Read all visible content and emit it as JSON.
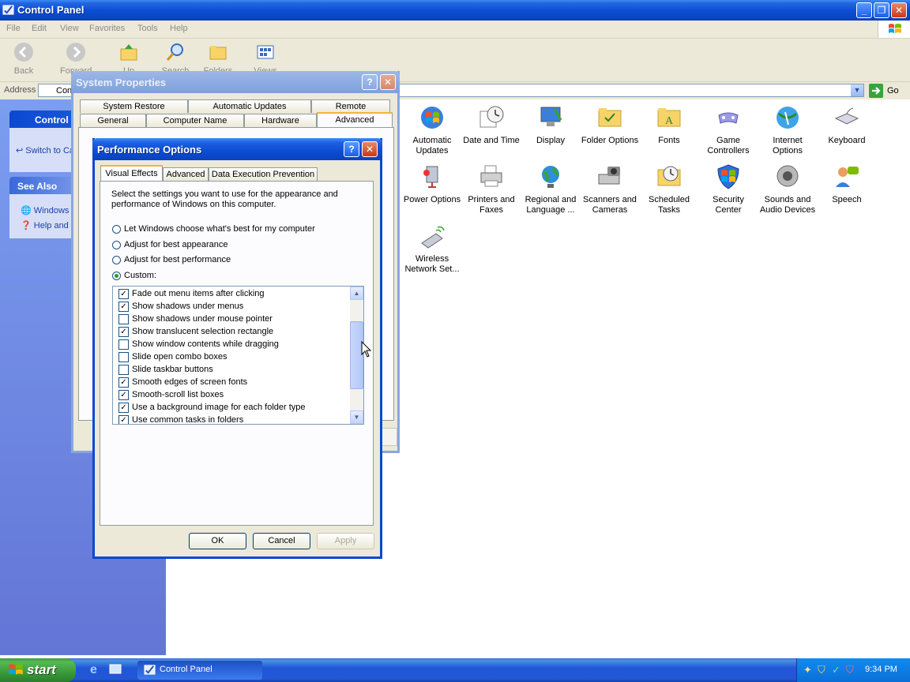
{
  "window": {
    "title": "Control Panel",
    "menu": [
      "File",
      "Edit",
      "View",
      "Favorites",
      "Tools",
      "Help"
    ],
    "toolbar": {
      "back": "Back",
      "forward": "Forward",
      "up": "Up",
      "search": "Search",
      "folders": "Folders",
      "views": "Views"
    },
    "address": {
      "label": "Address",
      "value": "Control Panel",
      "go": "Go"
    }
  },
  "left_pane": {
    "control_panel_title": "Control Panel",
    "switch_link": "Switch to Category View",
    "see_also_title": "See Also",
    "see_also": [
      "Windows Update",
      "Help and Support"
    ]
  },
  "control_panel_items": [
    {
      "label": "Automatic Updates",
      "icon": "automatic-updates-icon"
    },
    {
      "label": "Date and Time",
      "icon": "date-time-icon"
    },
    {
      "label": "Display",
      "icon": "display-icon"
    },
    {
      "label": "Folder Options",
      "icon": "folder-options-icon"
    },
    {
      "label": "Fonts",
      "icon": "fonts-icon"
    },
    {
      "label": "Game Controllers",
      "icon": "game-controllers-icon"
    },
    {
      "label": "Internet Options",
      "icon": "internet-options-icon"
    },
    {
      "label": "Keyboard",
      "icon": "keyboard-icon"
    },
    {
      "label": "Power Options",
      "icon": "power-options-icon"
    },
    {
      "label": "Printers and Faxes",
      "icon": "printers-icon"
    },
    {
      "label": "Regional and Language ...",
      "icon": "regional-icon"
    },
    {
      "label": "Scanners and Cameras",
      "icon": "scanners-icon"
    },
    {
      "label": "Scheduled Tasks",
      "icon": "scheduled-tasks-icon"
    },
    {
      "label": "Security Center",
      "icon": "security-center-icon"
    },
    {
      "label": "Sounds and Audio Devices",
      "icon": "sounds-icon"
    },
    {
      "label": "Speech",
      "icon": "speech-icon"
    },
    {
      "label": "Wireless Network Set...",
      "icon": "wireless-icon"
    }
  ],
  "system_properties": {
    "title": "System Properties",
    "tabs_back": [
      "System Restore",
      "Automatic Updates",
      "Remote"
    ],
    "tabs_front": [
      "General",
      "Computer Name",
      "Hardware",
      "Advanced"
    ],
    "active_tab": "Advanced"
  },
  "performance_options": {
    "title": "Performance Options",
    "tabs": [
      "Visual Effects",
      "Advanced",
      "Data Execution Prevention"
    ],
    "active_tab": "Visual Effects",
    "description": "Select the settings you want to use for the appearance and performance of Windows on this computer.",
    "radios": [
      {
        "label": "Let Windows choose what's best for my computer",
        "checked": false
      },
      {
        "label": "Adjust for best appearance",
        "checked": false
      },
      {
        "label": "Adjust for best performance",
        "checked": false
      },
      {
        "label": "Custom:",
        "checked": true
      }
    ],
    "effects": [
      {
        "label": "Fade out menu items after clicking",
        "checked": true
      },
      {
        "label": "Show shadows under menus",
        "checked": true
      },
      {
        "label": "Show shadows under mouse pointer",
        "checked": false
      },
      {
        "label": "Show translucent selection rectangle",
        "checked": true
      },
      {
        "label": "Show window contents while dragging",
        "checked": false
      },
      {
        "label": "Slide open combo boxes",
        "checked": false
      },
      {
        "label": "Slide taskbar buttons",
        "checked": false
      },
      {
        "label": "Smooth edges of screen fonts",
        "checked": true
      },
      {
        "label": "Smooth-scroll list boxes",
        "checked": true
      },
      {
        "label": "Use a background image for each folder type",
        "checked": true
      },
      {
        "label": "Use common tasks in folders",
        "checked": true
      }
    ],
    "buttons": {
      "ok": "OK",
      "cancel": "Cancel",
      "apply": "Apply"
    }
  },
  "taskbar": {
    "start": "start",
    "task": "Control Panel",
    "clock": "9:34 PM"
  },
  "colors": {
    "xp_blue": "#0a48d2",
    "dialog_face": "#ece9d8",
    "taskbar": "#2157d7",
    "start_green": "#3a9a3a"
  }
}
